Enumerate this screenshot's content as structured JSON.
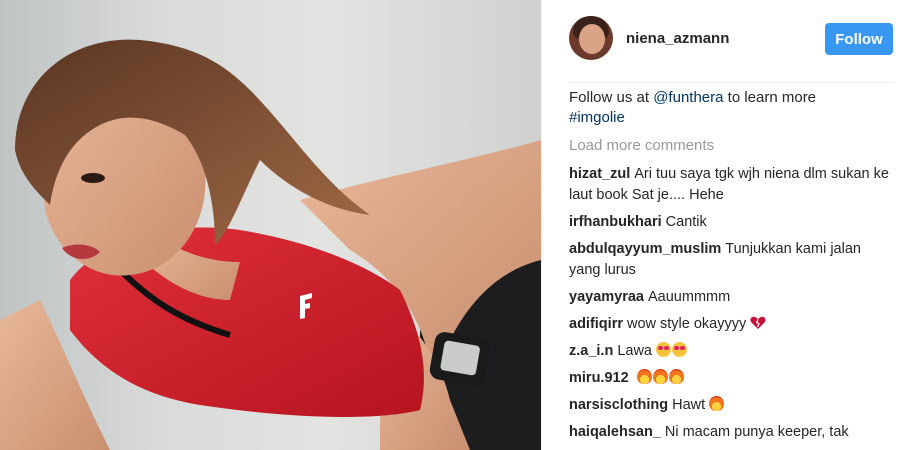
{
  "post": {
    "username": "niena_azmann",
    "follow_label": "Follow",
    "caption_text": "Follow us at ",
    "caption_mention": "@funthera",
    "caption_suffix": " to learn more",
    "caption_hashtag": "#imgolie",
    "load_more": "Load more comments",
    "image_alt": "woman in red athletic top leaning forward wearing a wristwatch"
  },
  "comments": [
    {
      "user": "hizat_zul",
      "text": "Ari tuu saya tgk wjh niena dlm sukan ke laut book Sat je.... Hehe",
      "emoji": []
    },
    {
      "user": "irfhanbukhari",
      "text": "Cantik",
      "emoji": []
    },
    {
      "user": "abdulqayyum_muslim",
      "text": "Tunjukkan kami jalan yang lurus",
      "emoji": []
    },
    {
      "user": "yayamyraa",
      "text": "Aauummmm",
      "emoji": []
    },
    {
      "user": "adifiqirr",
      "text": "wow style okayyyy",
      "emoji": [
        "broken-heart-icon"
      ]
    },
    {
      "user": "z.a_i.n",
      "text": "Lawa",
      "emoji": [
        "heart-eyes-icon",
        "heart-eyes-icon"
      ]
    },
    {
      "user": "miru.912",
      "text": "",
      "emoji": [
        "fire-icon",
        "fire-icon",
        "fire-icon"
      ]
    },
    {
      "user": "narsisclothing",
      "text": "Hawt",
      "emoji": [
        "fire-icon"
      ]
    },
    {
      "user": "haiqalehsan_",
      "text": "Ni macam punya keeper, tak",
      "emoji": []
    }
  ],
  "colors": {
    "follow_button": "#3897f0",
    "link": "#003569",
    "muted": "#999999",
    "top_red": "#d2202a"
  }
}
